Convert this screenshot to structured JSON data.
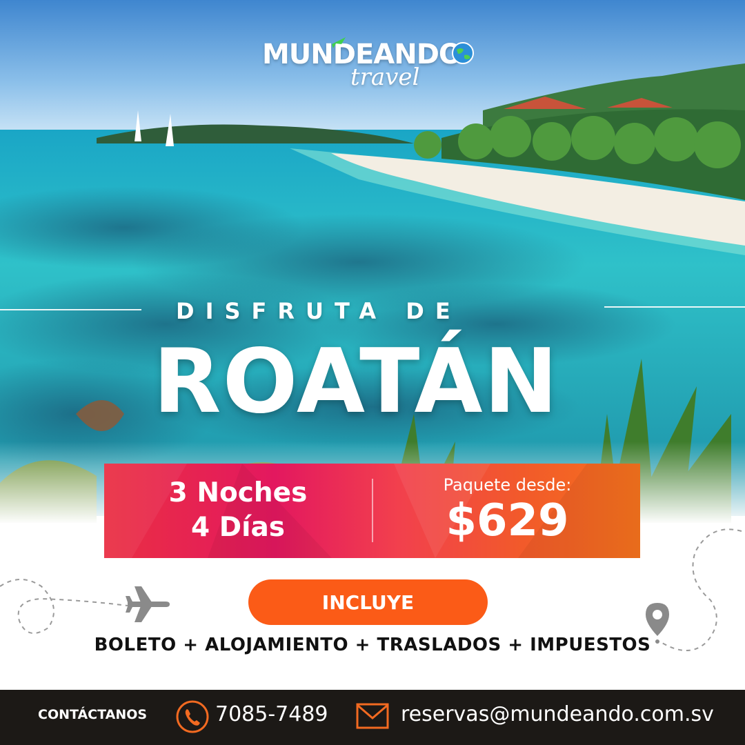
{
  "logo": {
    "brand": "MUNDEANDO",
    "tagline": "travel"
  },
  "headline": {
    "kicker": "DISFRUTA DE",
    "destination": "ROATÁN"
  },
  "package": {
    "nights": "3 Noches",
    "days": "4 Días",
    "price_label": "Paquete desde:",
    "price": "$629"
  },
  "includes": {
    "button_label": "INCLUYE",
    "items_text": "BOLETO + ALOJAMIENTO + TRASLADOS + IMPUESTOS"
  },
  "footer": {
    "contact_label": "CONTÁCTANOS",
    "phone": "7085-7489",
    "email": "reservas@mundeando.com.sv"
  },
  "icons": [
    "plane-icon",
    "globe-icon",
    "location-pin-icon",
    "phone-icon",
    "mail-icon"
  ],
  "colors": {
    "accent_orange": "#fb5b17",
    "banner_pink": "#e3185f",
    "footer_dark": "#1c1916",
    "icon_orange": "#f26a21"
  }
}
